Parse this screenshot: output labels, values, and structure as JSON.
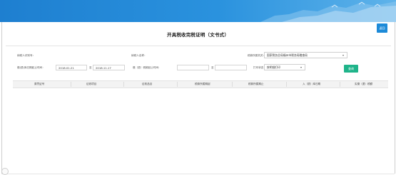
{
  "page": {
    "title": "开具税收完税证明（文书式）",
    "back_label": "返回"
  },
  "form": {
    "taxpayer_id_label": "纳税人识别号：",
    "taxpayer_name_label": "纳税人名称：",
    "tax_office_label": "税款所属机关：",
    "tax_office_value": "国家税务总局福州市税务局稽查局",
    "payment_date_label": "缴(退)库日期起止时间：",
    "date_from": "2018.01.21",
    "date_to_sep": "至",
    "date_to": "2018.11.17",
    "tax_period_label": "缴（退）税款起止时间：",
    "tax_period_sep": "至",
    "print_status_label": "打印状态：",
    "print_status_value": "按明细打印",
    "query_label": "查询"
  },
  "table": {
    "columns": [
      "原凭证号",
      "征收项目",
      "征收品目",
      "税款所属期起",
      "税款所属期止",
      "入（退）库日期",
      "实缴（退）税额"
    ]
  }
}
